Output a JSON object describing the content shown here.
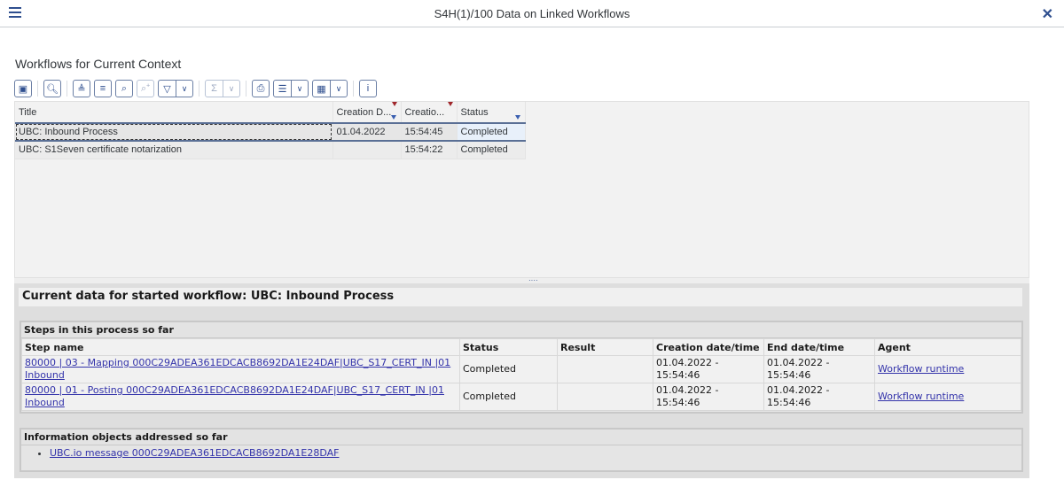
{
  "window": {
    "title": "S4H(1)/100 Data on Linked Workflows",
    "menu_icon": "hamburger-menu-icon",
    "close_icon": "close-icon"
  },
  "workflows": {
    "section_title": "Workflows for Current Context",
    "toolbar": [
      {
        "name": "details-icon",
        "glyph": "▣",
        "disabled": false,
        "dropdown": false
      },
      {
        "name": "zoom-detail-icon",
        "glyph": "🔍︎",
        "disabled": false,
        "dropdown": false
      },
      {
        "name": "sort-ascending-icon",
        "glyph": "≜",
        "disabled": false,
        "dropdown": false
      },
      {
        "name": "sort-descending-icon",
        "glyph": "≡",
        "disabled": false,
        "dropdown": false
      },
      {
        "name": "find-icon",
        "glyph": "⌕",
        "disabled": false,
        "dropdown": false
      },
      {
        "name": "find-next-icon",
        "glyph": "⌕⁺",
        "disabled": true,
        "dropdown": false
      },
      {
        "name": "filter-icon",
        "glyph": "▽",
        "disabled": false,
        "dropdown": true
      },
      {
        "name": "sum-icon",
        "glyph": "Σ",
        "disabled": true,
        "dropdown": true
      },
      {
        "name": "print-icon",
        "glyph": "⎙",
        "disabled": false,
        "dropdown": false
      },
      {
        "name": "view-icon",
        "glyph": "☰",
        "disabled": false,
        "dropdown": true
      },
      {
        "name": "layout-icon",
        "glyph": "▦",
        "disabled": false,
        "dropdown": true
      },
      {
        "name": "info-icon",
        "glyph": "i",
        "disabled": false,
        "dropdown": false
      }
    ],
    "columns": [
      "Title",
      "Creation D...",
      "Creatio...",
      "Status"
    ],
    "rows": [
      {
        "title": "UBC: Inbound Process",
        "date": "01.04.2022",
        "time": "15:54:45",
        "status": "Completed",
        "selected": true
      },
      {
        "title": "UBC: S1Seven certificate notarization",
        "date": "",
        "time": "15:54:22",
        "status": "Completed",
        "selected": false
      }
    ]
  },
  "detail": {
    "heading": "Current data for started workflow: UBC: Inbound Process",
    "steps": {
      "title": "Steps in this process so far",
      "columns": [
        "Step name",
        "Status",
        "Result",
        "Creation date/time",
        "End date/time",
        "Agent"
      ],
      "rows": [
        {
          "step": "80000 | 03 - Mapping 000C29ADEA361EDCACB8692DA1E24DAF|UBC_S17_CERT_IN |01 Inbound",
          "status": "Completed",
          "result": "",
          "created": "01.04.2022 - 15:54:46",
          "ended": "01.04.2022 - 15:54:46",
          "agent": "Workflow runtime"
        },
        {
          "step": "80000 | 01 - Posting 000C29ADEA361EDCACB8692DA1E24DAF|UBC_S17_CERT_IN |01 Inbound",
          "status": "Completed",
          "result": "",
          "created": "01.04.2022 - 15:54:46",
          "ended": "01.04.2022 - 15:54:46",
          "agent": "Workflow runtime"
        }
      ]
    },
    "info_objects": {
      "title": "Information objects addressed so far",
      "items": [
        "UBC.io message 000C29ADEA361EDCACB8692DA1E28DAF"
      ]
    }
  },
  "splitter_grip": "····"
}
